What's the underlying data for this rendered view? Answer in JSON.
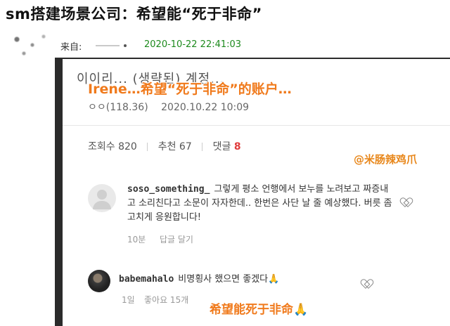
{
  "header": {
    "title": "sm搭建场景公司：希望能“死于非命”",
    "from_label": "来自:",
    "timestamp": "2020-10-22 22:41:03"
  },
  "post": {
    "title_cut": "이이리... (생략된) 계정...",
    "title_overlay": "Irene…希望“死于非命”的账户…",
    "author_ip": "ㅇㅇ(118.36)",
    "date": "2020.10.22 10:09",
    "stats": {
      "views_label": "조회수 820",
      "recommend_label": "추천 67",
      "comments_label": "댓글",
      "comments_count": "8"
    },
    "watermark": "@米肠辣鸡爪"
  },
  "comments": [
    {
      "user": "soso_something_",
      "text": "그렇게 평소 언행에서 보누를 노려보고 짜증내고 소리친다고 소문이 자자한데.. 한번은 사단 날 줄 예상했다. 버릇 좀 고치게 응원합니다!",
      "time": "10분",
      "reply_label": "답글 달기"
    },
    {
      "user": "babemahalo",
      "text": "비명횡사 했으면 좋겠다🙏",
      "time": "1일",
      "likes_label": "좋아요 15개"
    }
  ],
  "caption_overlay": "希望能死于非命🙏"
}
